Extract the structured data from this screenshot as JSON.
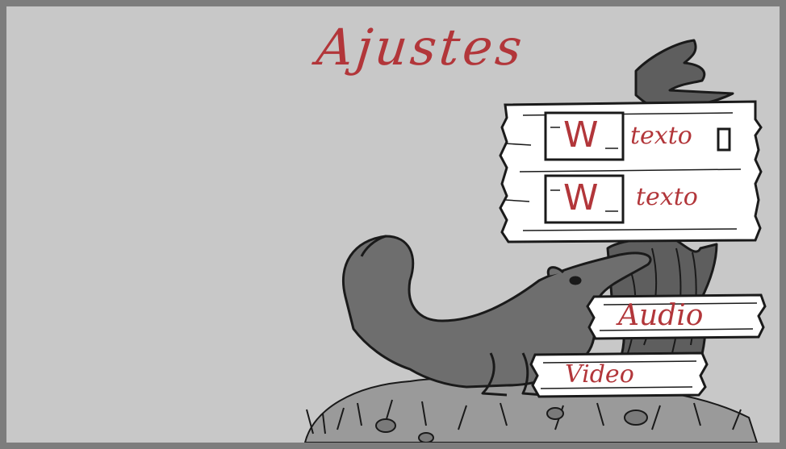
{
  "screen": {
    "title": "Ajustes"
  },
  "settings_sign": {
    "rows": [
      {
        "icon": "W",
        "label": "texto",
        "has_toggle": true
      },
      {
        "icon": "W",
        "label": "texto",
        "has_toggle": false
      }
    ]
  },
  "buttons": {
    "audio_label": "Audio",
    "video_label": "Video"
  },
  "colors": {
    "background": "#c8c8c8",
    "frame": "#7d7d7d",
    "accent_red": "#b2363a",
    "board": "#ffffff",
    "ink": "#1a1a1a",
    "creature": "#6e6e6e"
  }
}
